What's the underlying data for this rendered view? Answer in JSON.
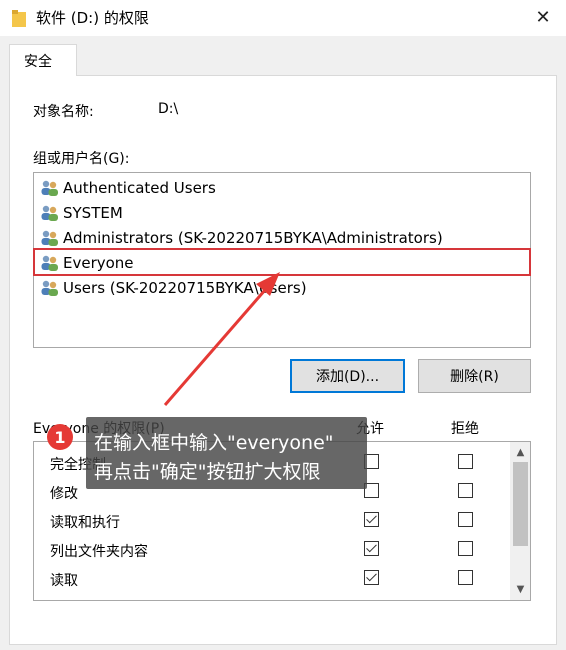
{
  "window": {
    "title": "软件 (D:) 的权限",
    "close_glyph": "✕",
    "icon": "folder-icon"
  },
  "tabs": [
    {
      "label": "安全",
      "active": true
    }
  ],
  "object": {
    "label": "对象名称:",
    "value": "D:\\"
  },
  "users": {
    "label": "组或用户名(G):",
    "items": [
      {
        "label": "Authenticated Users",
        "icon": "users-icon"
      },
      {
        "label": "SYSTEM",
        "icon": "users-icon"
      },
      {
        "label": "Administrators (SK-20220715BYKA\\Administrators)",
        "icon": "users-icon"
      },
      {
        "label": "Everyone",
        "icon": "users-icon",
        "selected": true
      },
      {
        "label": "Users (SK-20220715BYKA\\Users)",
        "icon": "users-icon"
      }
    ]
  },
  "buttons": {
    "add": "添加(D)...",
    "remove": "删除(R)"
  },
  "permissions": {
    "header_label": "Everyone 的权限(P)",
    "allow_header": "允许",
    "deny_header": "拒绝",
    "rows": [
      {
        "name": "完全控制",
        "allow": false,
        "deny": false
      },
      {
        "name": "修改",
        "allow": false,
        "deny": false
      },
      {
        "name": "读取和执行",
        "allow": true,
        "deny": false
      },
      {
        "name": "列出文件夹内容",
        "allow": true,
        "deny": false
      },
      {
        "name": "读取",
        "allow": true,
        "deny": false
      }
    ]
  },
  "annotation": {
    "step": "1",
    "line1": "在输入框中输入\"everyone\"",
    "line2": "再点击\"确定\"按钮扩大权限",
    "highlight_color": "#d6363a"
  }
}
